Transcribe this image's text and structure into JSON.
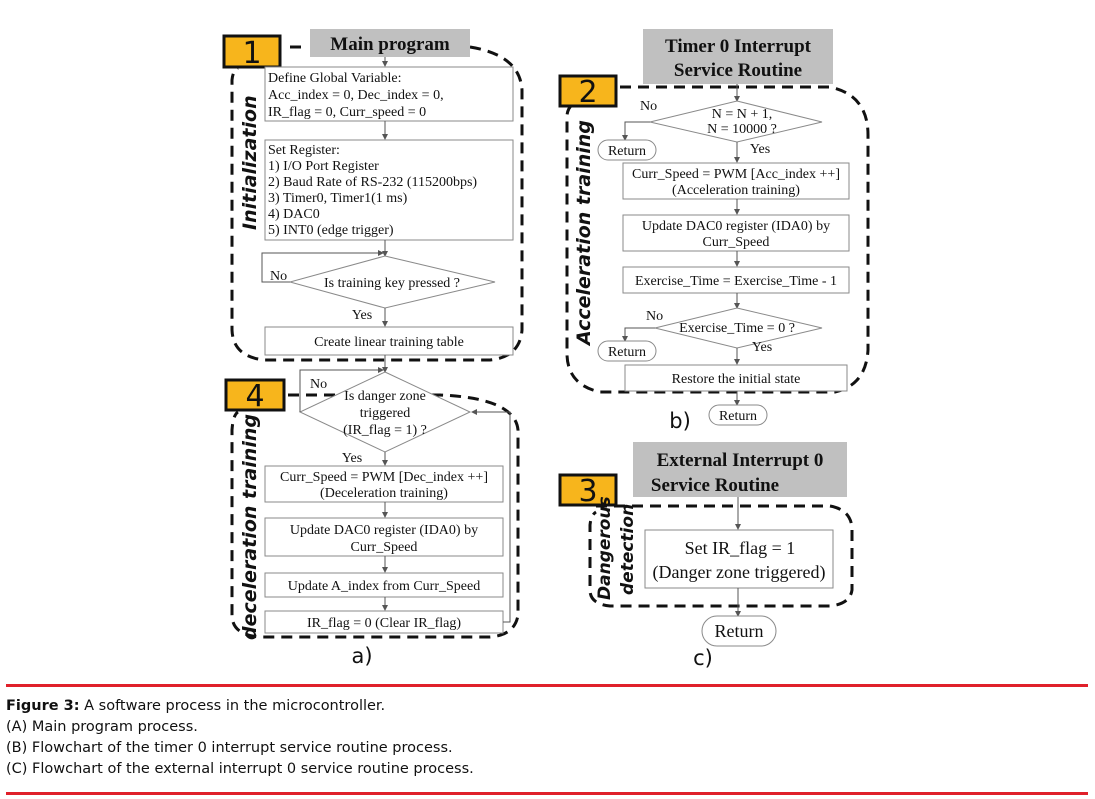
{
  "panel_a": {
    "header": "Main program",
    "badge_init": "1",
    "badge_dec": "4",
    "section_init": "Initialization",
    "section_dec": "deceleration training",
    "define_vars": [
      "Define Global Variable:",
      "Acc_index = 0, Dec_index = 0,",
      "IR_flag = 0, Curr_speed = 0"
    ],
    "set_register": [
      "Set Register:",
      "1) I/O Port Register",
      "2) Baud Rate of RS-232 (115200bps)",
      "3) Timer0, Timer1(1 ms)",
      "4) DAC0",
      "5) INT0 (edge trigger)"
    ],
    "decision_key": "Is  training key pressed ?",
    "no1": "No",
    "yes1": "Yes",
    "create_table": "Create  linear training table",
    "decision_danger": [
      "Is  danger zone",
      "triggered",
      "(IR_flag = 1) ?"
    ],
    "no2": "No",
    "yes2": "Yes",
    "dec_speed": [
      "Curr_Speed = PWM [Dec_index ++]",
      "(Deceleration training)"
    ],
    "dac_update": [
      "Update DAC0 register (IDA0) by",
      "Curr_Speed"
    ],
    "update_a_index": "Update A_index from Curr_Speed",
    "clear_flag": "IR_flag = 0 (Clear IR_flag)",
    "label": "a)"
  },
  "panel_b": {
    "header": [
      "Timer 0 Interrupt",
      "Service Routine"
    ],
    "badge": "2",
    "section": "Acceleration training",
    "decision_n": [
      "N = N + 1,",
      "N = 10000 ?"
    ],
    "no1": "No",
    "yes1": "Yes",
    "return1": "Return",
    "acc_speed": [
      "Curr_Speed = PWM [Acc_index ++]",
      "(Acceleration training)"
    ],
    "dac_update": [
      "Update DAC0 register (IDA0) by",
      "Curr_Speed"
    ],
    "exercise_dec": "Exercise_Time  = Exercise_Time - 1",
    "decision_exercise": "Exercise_Time  = 0 ?",
    "no2": "No",
    "yes2": "Yes",
    "return2": "Return",
    "restore": "Restore the initial state",
    "return3": "Return",
    "label": "b)"
  },
  "panel_c": {
    "header": [
      "External Interrupt 0",
      "Service Routine"
    ],
    "badge": "3",
    "section": [
      "Dangerous",
      "detection"
    ],
    "set_flag": [
      "Set IR_flag = 1",
      "(Danger zone triggered)"
    ],
    "return": "Return",
    "label": "c)"
  },
  "caption": {
    "title": "Figure 3:",
    "title_text": " A software process in the microcontroller.",
    "lines": [
      "(A) Main program process.",
      "(B) Flowchart of the timer 0 interrupt service routine process.",
      "(C) Flowchart of the external interrupt 0 service routine process."
    ]
  }
}
